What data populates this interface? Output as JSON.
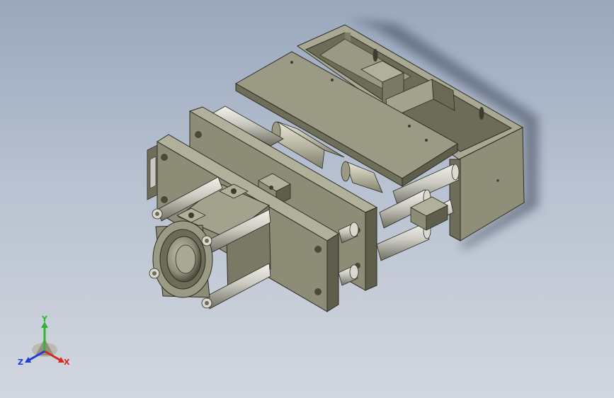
{
  "viewport": {
    "background_top": "#9aa8bd",
    "background_bottom": "#d2d7df",
    "model_name": "pneumatic-slide-cylinder-assembly",
    "model_color": "#8d8c76",
    "model_dark": "#5f5e4d",
    "model_light": "#b1b09b",
    "rod_color": "#c9c9c0"
  },
  "triad": {
    "x_label": "X",
    "y_label": "Y",
    "z_label": "Z",
    "x_color": "#d62a1e",
    "y_color": "#2fb52f",
    "z_color": "#2438d6"
  }
}
